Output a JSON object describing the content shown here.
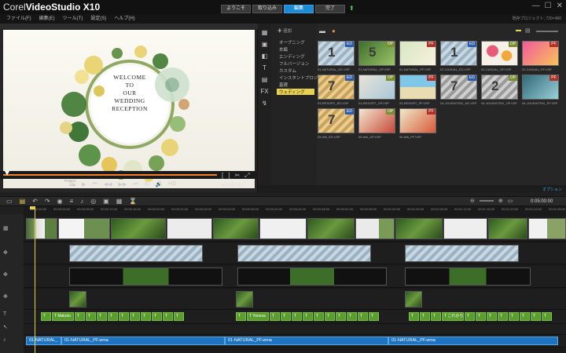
{
  "app": {
    "title_prefix": "Corel",
    "title_bold": "VideoStudio X10"
  },
  "menu": [
    "ファイル(F)",
    "編集(E)",
    "ツール(T)",
    "設定(S)",
    "ヘルプ(H)"
  ],
  "steps": [
    {
      "label": "ようこそ"
    },
    {
      "label": "取り込み"
    },
    {
      "label": "編集",
      "active": true
    },
    {
      "label": "完了"
    }
  ],
  "top_right_info": "既存プロジェクト, 720×480",
  "preview": {
    "welcome_lines": [
      "WELCOME",
      "TO",
      "OUR",
      "WEDDING",
      "RECEPTION"
    ],
    "project_label": "Project",
    "clip_label": "Clip",
    "timecode": "00:05:00",
    "hd_label": "HD"
  },
  "library": {
    "add_label": "追加",
    "categories": [
      "オープニング",
      "本編",
      "エンディング",
      "フルバージョン",
      "カスタム",
      "インスタントプロジェ...",
      "基礎",
      "ウェディング"
    ],
    "selected_category": "ウェディング",
    "bottom_label": "参照",
    "options_label": "オプション",
    "thumbs": [
      {
        "name": "01-NATURAL_ED.VSP",
        "badge": "ED",
        "num": "1",
        "style": "hatch"
      },
      {
        "name": "01-NATURAL_OP.VSP",
        "badge": "OP",
        "num": "5",
        "style": "green"
      },
      {
        "name": "01-NATURAL_PF.VSP",
        "badge": "PF",
        "num": "",
        "style": "photo1"
      },
      {
        "name": "02-CASUAL_ED.VSP",
        "badge": "ED",
        "num": "1",
        "style": "hatch"
      },
      {
        "name": "02-CASUAL_OP.VSP",
        "badge": "OP",
        "num": "",
        "style": "flowers"
      },
      {
        "name": "02-CASUAL_PF.VSP",
        "badge": "PF",
        "num": "",
        "style": "pink"
      },
      {
        "name": "03-RESORT_ED.VSP",
        "badge": "ED",
        "num": "7",
        "style": "ochre"
      },
      {
        "name": "03-RESORT_OP.VSP",
        "badge": "OP",
        "num": "",
        "style": "sign"
      },
      {
        "name": "03-RESORT_PF.VSP",
        "badge": "PF",
        "num": "",
        "style": "beach"
      },
      {
        "name": "04-JOUSHITEKI_ED.VSP",
        "badge": "ED",
        "num": "7",
        "style": "grey"
      },
      {
        "name": "04-JOUSHITEKI_OP.VSP",
        "badge": "OP",
        "num": "2",
        "style": "grey"
      },
      {
        "name": "04-JOUSHITEKI_PF.VSP",
        "badge": "PF",
        "num": "",
        "style": "teal"
      },
      {
        "name": "05-WA_ED.VSP",
        "badge": "ED",
        "num": "7",
        "style": "ochre"
      },
      {
        "name": "05-WA_OP.VSP",
        "badge": "OP",
        "num": "",
        "style": "wa"
      },
      {
        "name": "05-WA_PF.VSP",
        "badge": "PF",
        "num": "",
        "style": "wapf"
      }
    ]
  },
  "timeline": {
    "timecode": "0:05:00:00",
    "ruler_ticks": [
      "00:00:00:00",
      "00:00:04:00",
      "00:00:08:00",
      "00:00:12:00",
      "00:00:16:00",
      "00:00:20:00",
      "00:00:24:00",
      "00:00:28:00",
      "00:00:32:00",
      "00:00:36:00",
      "00:00:40:00",
      "00:00:44:00",
      "00:00:48:00",
      "00:00:52:00",
      "00:00:56:00",
      "00:01:00:00",
      "00:01:04:00",
      "00:01:08:00",
      "00:01:12:00",
      "00:01:16:00",
      "00:01:20:00",
      "00:01:24:00",
      "00:01:28:00"
    ],
    "title_texts": [
      "Makoto",
      "Yoneza",
      "これから"
    ],
    "audio_clips": [
      "01-NATURAL_",
      "01-NATURAL_PF.wma",
      "01-NATURAL_PF.wma",
      "01-NATURAL_PF.wma"
    ]
  },
  "colors": {
    "accent": "#1d8ad6",
    "selected_category": "#e8d050",
    "title_clip": "#5a9e2e",
    "audio_clip": "#1d73c0",
    "scrub": "#f08030"
  }
}
